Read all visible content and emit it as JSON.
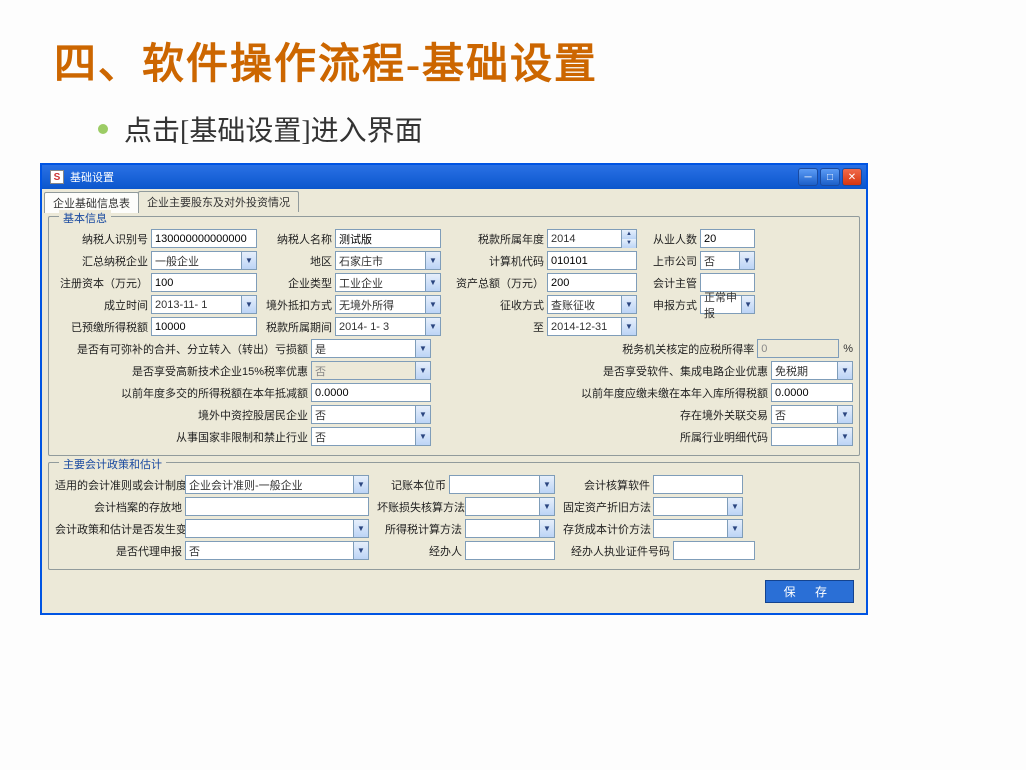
{
  "slide": {
    "title": "四、软件操作流程-基础设置",
    "bullet": "点击[基础设置]进入界面"
  },
  "window": {
    "title": "基础设置"
  },
  "tabs": {
    "t1": "企业基础信息表",
    "t2": "企业主要股东及对外投资情况"
  },
  "legend": {
    "basic": "基本信息",
    "acct": "主要会计政策和估计"
  },
  "labels": {
    "taxpayer_id": "纳税人识别号",
    "taxpayer_name": "纳税人名称",
    "tax_year": "税款所属年度",
    "employees": "从业人数",
    "consol_ent": "汇总纳税企业",
    "region": "地区",
    "pc_code": "计算机代码",
    "listed": "上市公司",
    "reg_capital": "注册资本（万元）",
    "ent_type": "企业类型",
    "total_assets": "资产总额（万元）",
    "acct_mgr": "会计主管",
    "found_date": "成立时间",
    "foreign_credit": "境外抵扣方式",
    "collect_method": "征收方式",
    "declare_method": "申报方式",
    "prepaid": "已预缴所得税额",
    "tax_period": "税款所属期间",
    "period_to": "至",
    "q_merge_loss": "是否有可弥补的合并、分立转入（转出）亏损额",
    "tax_rate": "税务机关核定的应税所得率",
    "q_hitech": "是否享受高新技术企业15%税率优惠",
    "q_software": "是否享受软件、集成电路企业优惠",
    "prev_credit": "以前年度多交的所得税额在本年抵减额",
    "prev_owe": "以前年度应缴未缴在本年入库所得税额",
    "foreign_ctrl": "境外中资控股居民企业",
    "foreign_trade": "存在境外关联交易",
    "restrict_ind": "从事国家非限制和禁止行业",
    "ind_detail": "所属行业明细代码",
    "acct_system": "适用的会计准则或会计制度",
    "base_ccy": "记账本位币",
    "acct_sw": "会计核算软件",
    "archive_loc": "会计档案的存放地",
    "baddebt": "坏账损失核算方法",
    "dep_method": "固定资产折旧方法",
    "policy_change": "会计政策和估计是否发生变化",
    "tax_calc_method": "所得税计算方法",
    "inv_cost": "存货成本计价方法",
    "is_agent": "是否代理申报",
    "agent": "经办人",
    "agent_cert": "经办人执业证件号码"
  },
  "values": {
    "taxpayer_id": "130000000000000",
    "taxpayer_name": "测试版",
    "tax_year": "2014",
    "employees": "20",
    "consol_ent": "一般企业",
    "region": "石家庄市",
    "pc_code": "010101",
    "listed": "否",
    "reg_capital": "100",
    "ent_type": "工业企业",
    "total_assets": "200",
    "acct_mgr": "",
    "found_date": "2013-11- 1",
    "foreign_credit": "无境外所得",
    "collect_method": "查账征收",
    "declare_method": "正常申报",
    "prepaid": "10000",
    "tax_period": "2014- 1- 3",
    "period_to": "2014-12-31",
    "q_merge_loss": "是",
    "tax_rate": "0",
    "q_hitech": "否",
    "q_software": "免税期",
    "prev_credit": "0.0000",
    "prev_owe": "0.0000",
    "foreign_ctrl": "否",
    "foreign_trade": "否",
    "restrict_ind": "否",
    "ind_detail": "",
    "acct_system": "企业会计准则-一般企业",
    "base_ccy": "",
    "acct_sw": "",
    "archive_loc": "",
    "baddebt": "",
    "dep_method": "",
    "policy_change": "",
    "tax_calc_method": "",
    "inv_cost": "",
    "is_agent": "否",
    "agent": "",
    "agent_cert": ""
  },
  "buttons": {
    "save": "保 存"
  }
}
